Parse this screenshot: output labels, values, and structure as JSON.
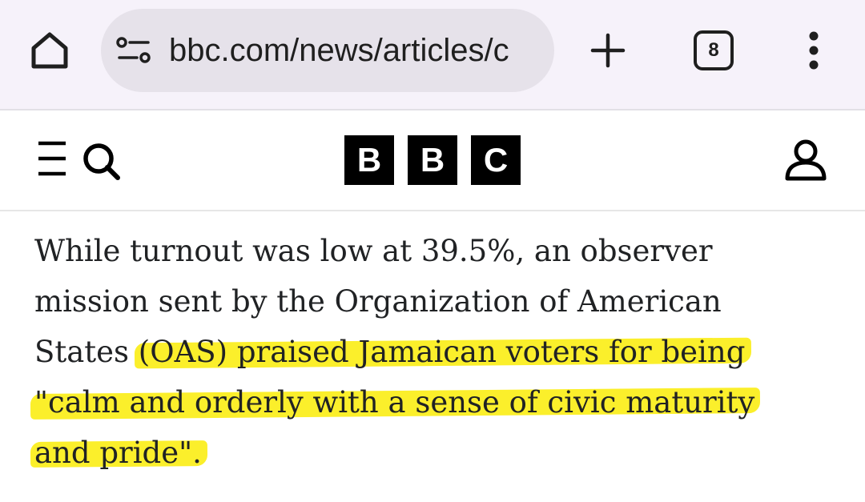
{
  "browser": {
    "url": "bbc.com/news/articles/c",
    "tab_count": "8",
    "icons": [
      "home-icon",
      "site-info-icon",
      "plus-icon",
      "tab-switcher-icon",
      "more-vert-icon"
    ]
  },
  "header": {
    "logo_letters": [
      "B",
      "B",
      "C"
    ],
    "icons": [
      "menu-search-icon",
      "account-icon"
    ]
  },
  "article": {
    "line1": "While turnout was low at 39.5%, an observer",
    "line2": "mission sent by the Organization of American",
    "line3_plain": "States ",
    "line3_highlighted": "(OAS) praised Jamaican voters for being",
    "line4_highlighted": "\"calm and orderly with a sense of civic maturity",
    "line5_highlighted": "and pride\"."
  },
  "colors": {
    "highlight": "#fbef2b",
    "browser_bar": "#f6f2fa",
    "omnibox": "#e6e2ea",
    "text": "#202224",
    "logo": "#000000"
  }
}
